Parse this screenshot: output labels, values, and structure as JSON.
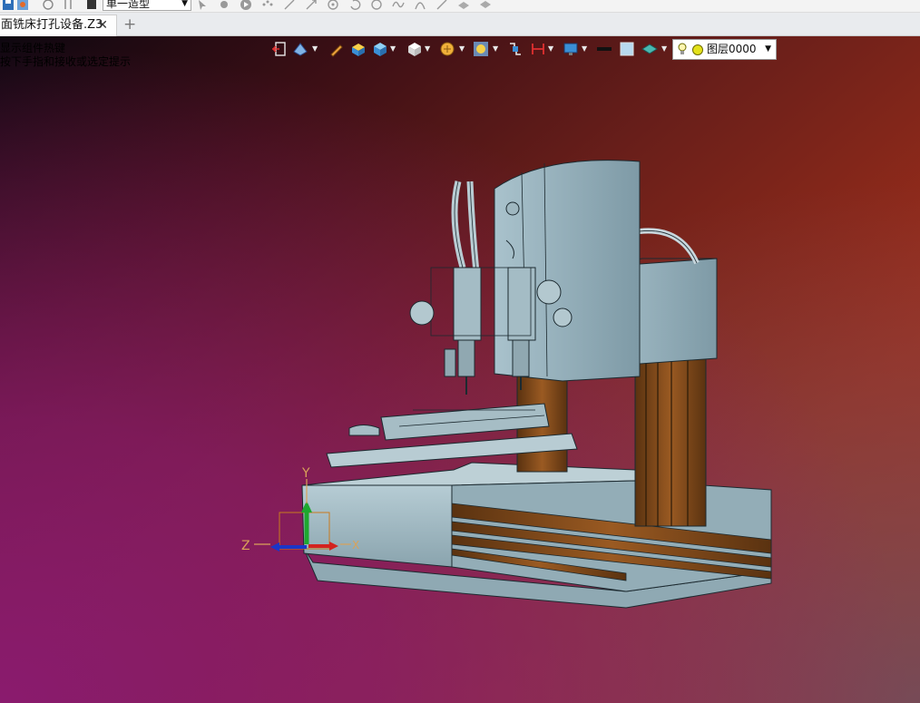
{
  "toolbar": {
    "mode_value": "单一造型",
    "icons": [
      "save-icon",
      "refresh-icon",
      "pin-icon",
      "rect-icon",
      "select-arrow-icon",
      "gear-icon",
      "play-icon",
      "dots-icon",
      "line-icon",
      "arrow-line-icon",
      "circle-target-icon",
      "rotate-icon",
      "curve-icon",
      "arch-icon",
      "edge-icon",
      "surface-icon",
      "layers-icon"
    ]
  },
  "tabs": {
    "active_label": "面铣床打孔设备.Z3",
    "close_symbol": "✕",
    "add_symbol": "+"
  },
  "viewport": {
    "hint_lines": [
      "显示组件热键",
      "按下手指和接收或选定提示"
    ],
    "view_tools": [
      "exit-icon",
      "display-mode-icon",
      "pencil-icon",
      "box-shade-icon",
      "box-blue-icon",
      "cube-view-icon",
      "render-icon",
      "zoom-fit-icon",
      "snap-icon",
      "section-icon",
      "monitor-icon",
      "line-style-icon",
      "color-swatch-icon",
      "layer-shape-icon"
    ],
    "layer": {
      "label": "图层0000",
      "dot_color": "#e3e11a"
    },
    "axes": {
      "z_label": "Z",
      "y_label": "Y",
      "x_label": "X"
    },
    "background": {
      "top_right": "#b3381a",
      "bottom_left": "#8a1b6e"
    }
  }
}
